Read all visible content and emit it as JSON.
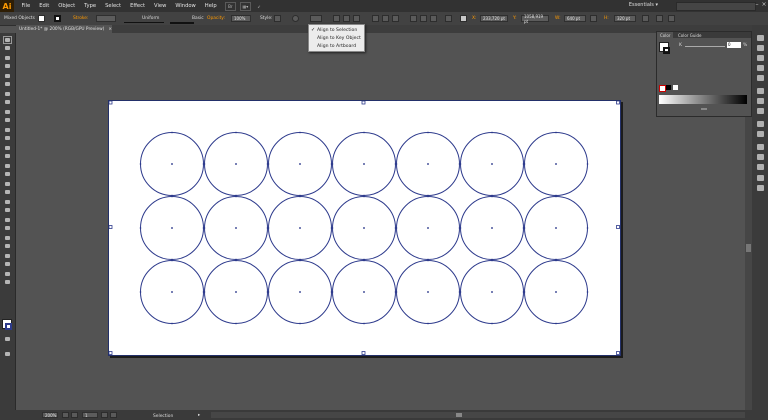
{
  "app": {
    "logo": "Ai",
    "menu": [
      "File",
      "Edit",
      "Object",
      "Type",
      "Select",
      "Effect",
      "View",
      "Window",
      "Help"
    ],
    "bridge_label": "Br",
    "workspace": "Essentials"
  },
  "control_bar": {
    "selection_label": "Mixed Objects",
    "stroke_label": "Stroke:",
    "stroke_profile": "Uniform",
    "brush": "Basic",
    "opacity_label": "Opacity:",
    "opacity_value": "100%",
    "style_label": "Style:",
    "x_value": "233,720 pt",
    "y_value": "1058,919 pt",
    "w_value": "640 pt",
    "h_value": "320 pt"
  },
  "align_menu": {
    "items": [
      {
        "label": "Align to Selection",
        "checked": true
      },
      {
        "label": "Align to Key Object",
        "checked": false
      },
      {
        "label": "Align to Artboard",
        "checked": false
      }
    ]
  },
  "document": {
    "tab_title": "Untitled-1* @ 200% (RGB/GPU Preview)",
    "close": "×"
  },
  "artboard": {
    "grid": {
      "rows": 3,
      "cols": 7
    },
    "stroke_color": "#2d3a8c",
    "selection_color": "#2d3a8c"
  },
  "color_panel": {
    "tabs": [
      "Color",
      "Color Guide"
    ],
    "k_label": "K",
    "k_value": "0",
    "percent": "%"
  },
  "status_bar": {
    "zoom": "200%",
    "artboard_num": "1",
    "tool_name": "Selection"
  },
  "colors": {
    "accent": "#ff9a00",
    "chrome_dark": "#323232",
    "canvas_bg": "#535353"
  }
}
